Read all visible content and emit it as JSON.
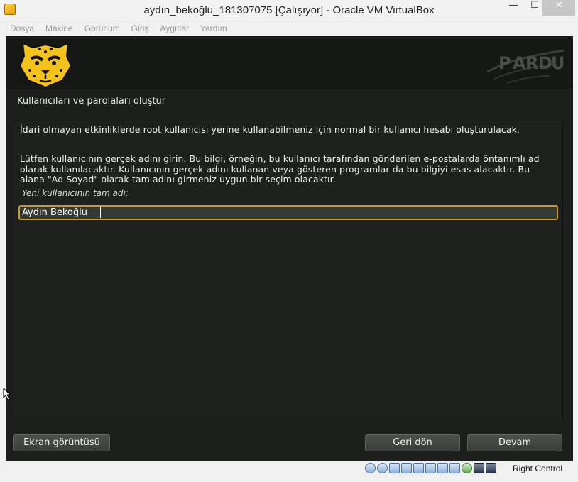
{
  "window": {
    "title": "aydın_bekoğlu_181307075 [Çalışıyor] - Oracle VM VirtualBox",
    "minimize": "—",
    "maximize": "☐",
    "close": "✕"
  },
  "menu": [
    "Dosya",
    "Makine",
    "Görünüm",
    "Giriş",
    "Aygıtlar",
    "Yardım"
  ],
  "installer": {
    "title": "Kullanıcıları ve parolaları oluştur",
    "paragraph1": "İdari olmayan etkinliklerde root kullanıcısı yerine kullanabilmeniz için normal bir kullanıcı hesabı oluşturulacak.",
    "paragraph2": "Lütfen kullanıcının gerçek adını girin. Bu bilgi, örneğin, bu kullanıcı tarafından gönderilen e-postalarda öntanımlı ad olarak kullanılacaktır. Kullanıcının gerçek adını kullanan veya gösteren programlar da bu bilgiyi esas alacaktır. Bu alana \"Ad Soyad\" olarak tam adını girmeniz uygun bir seçim olacaktır.",
    "field_label": "Yeni kullanıcının tam adı:",
    "full_name_value": "Aydın Bekoğlu",
    "logo_icon": "cheetah-icon",
    "brand_logo": "pardus-logo",
    "buttons": {
      "screenshot": "Ekran görüntüsü",
      "back": "Geri dön",
      "next": "Devam"
    }
  },
  "statusbar": {
    "host_key": "Right Control",
    "icons": [
      "hard-disk-icon",
      "optical-drive-icon",
      "audio-icon",
      "network-icon",
      "usb-icon",
      "shared-folders-icon",
      "display-icon",
      "video-capture-icon",
      "mouse-integration-icon",
      "virtualization-icon",
      "host-key-icon"
    ]
  },
  "colors": {
    "guest_background": "#1c1f1b",
    "accent_gold": "#c59a2e",
    "text": "#f0f0f0"
  }
}
